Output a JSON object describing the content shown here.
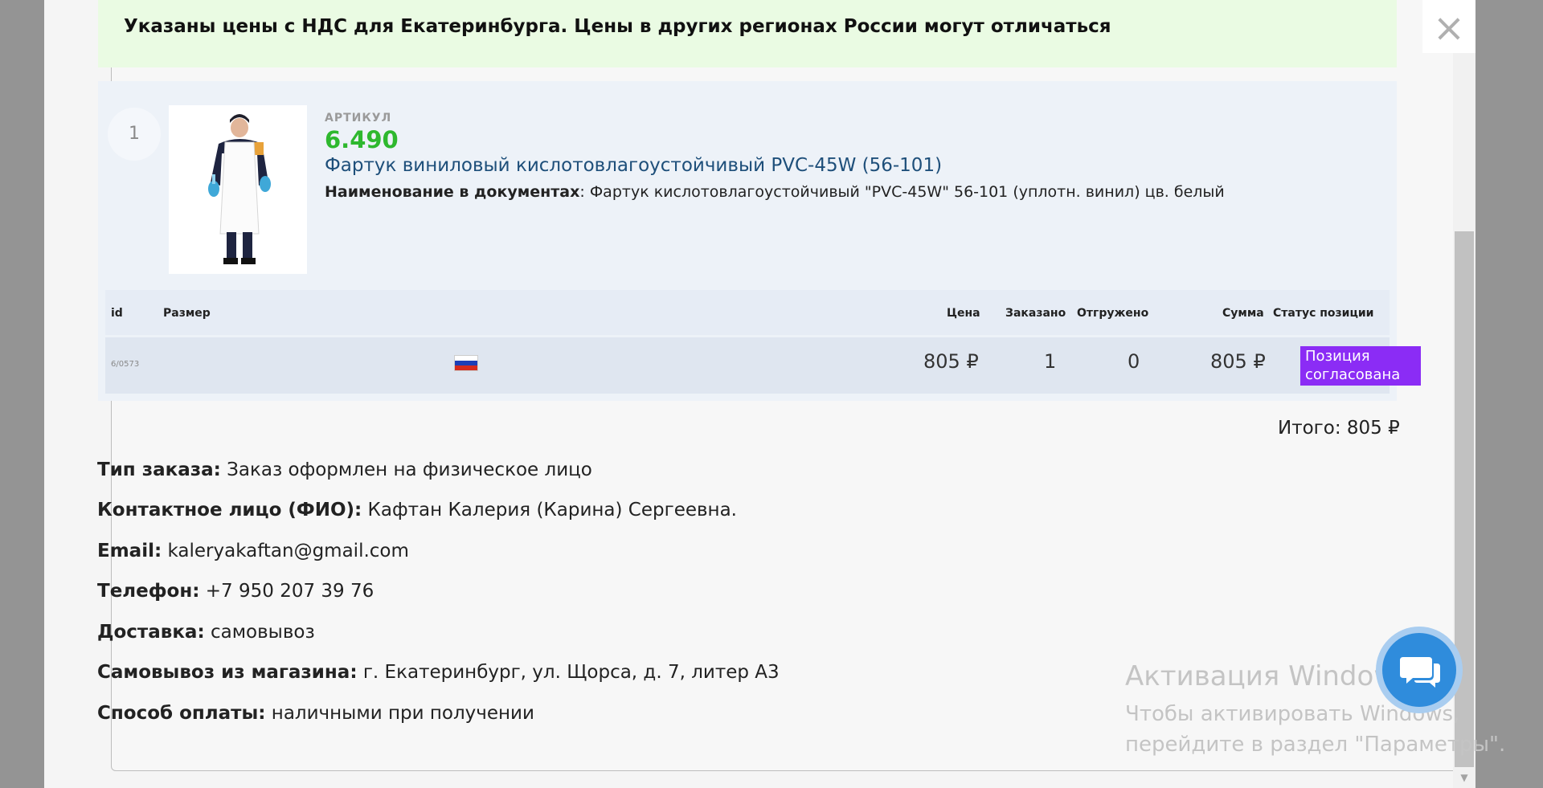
{
  "notice": "Указаны цены с НДС для Екатеринбурга. Цены в других регионах России могут отличаться",
  "close_symbol": "×",
  "item": {
    "number": "1",
    "sku_label": "АРТИКУЛ",
    "sku": "6.490",
    "title": "Фартук виниловый кислотовлагоустойчивый PVC-45W (56-101)",
    "doc_name_label": "Наименование в документах",
    "doc_name_value": ": Фартук кислотовлагоустойчивый \"PVC-45W\" 56-101 (уплотн. винил) цв. белый",
    "photo_icon": "apron-product-photo"
  },
  "table": {
    "headers": {
      "id": "id",
      "size": "Размер",
      "price": "Цена",
      "ordered": "Заказано",
      "shipped": "Отгружено",
      "sum": "Сумма",
      "status": "Статус позиции"
    },
    "row": {
      "id": "6/0573",
      "flag_icon": "russia-flag-icon",
      "price": "805 ₽",
      "ordered": "1",
      "shipped": "0",
      "sum": "805 ₽",
      "status": "Позиция согласована"
    }
  },
  "total": "Итого: 805 ₽",
  "details": [
    {
      "label": "Тип заказа:",
      "value": " Заказ оформлен на физическое лицо"
    },
    {
      "label": "Контактное лицо (ФИО):",
      "value": " Кафтан Калерия (Карина) Сергеевна."
    },
    {
      "label": "Email:",
      "value": " kaleryakaftan@gmail.com"
    },
    {
      "label": "Телефон:",
      "value": " +7 950 207 39 76"
    },
    {
      "label": "Доставка:",
      "value": " самовывоз"
    },
    {
      "label": "Самовывоз из магазина:",
      "value": " г. Екатеринбург, ул. Щорса, д. 7, литер А3"
    },
    {
      "label": "Способ оплаты:",
      "value": " наличными при получении"
    }
  ],
  "watermark": {
    "title": "Активация Windows",
    "line1": "Чтобы активировать Windows,",
    "line2": "перейдите в раздел \"Параметры\"."
  },
  "colors": {
    "notice_bg": "#eafbe3",
    "sku_green": "#2eb82e",
    "title_blue": "#1e4f7a",
    "status_purple": "#8b2cf5",
    "chat_blue": "#2f8cdc"
  }
}
